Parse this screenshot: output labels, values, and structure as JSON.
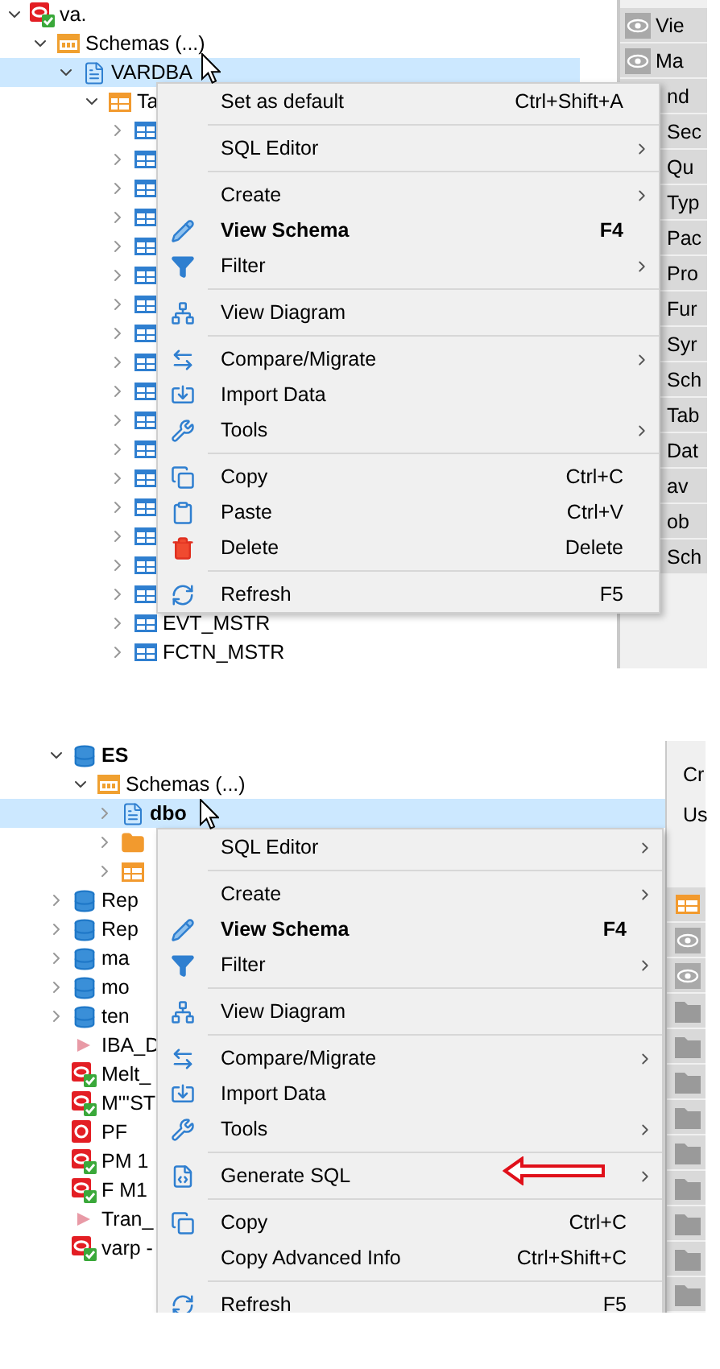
{
  "panels": [
    {
      "tree": [
        {
          "kind": "connected",
          "label": "va.",
          "expanded": true,
          "selected": false,
          "children": [
            {
              "kind": "schemas",
              "label": "Schemas (...)",
              "expanded": true,
              "selected": false,
              "children": [
                {
                  "kind": "schema",
                  "label": "VARDBA",
                  "expanded": true,
                  "selected": true,
                  "children": [
                    {
                      "kind": "tables",
                      "label": "Ta",
                      "expanded": true,
                      "selected": false,
                      "children": [
                        {
                          "kind": "table",
                          "expanded": false,
                          "selected": false
                        },
                        {
                          "kind": "table",
                          "expanded": false,
                          "selected": false
                        },
                        {
                          "kind": "table",
                          "expanded": false,
                          "selected": false
                        },
                        {
                          "kind": "table",
                          "expanded": false,
                          "selected": false
                        },
                        {
                          "kind": "table",
                          "expanded": false,
                          "selected": false
                        },
                        {
                          "kind": "table",
                          "expanded": false,
                          "selected": false
                        },
                        {
                          "kind": "table",
                          "expanded": false,
                          "selected": false
                        },
                        {
                          "kind": "table",
                          "expanded": false,
                          "selected": false
                        },
                        {
                          "kind": "table",
                          "expanded": false,
                          "selected": false
                        },
                        {
                          "kind": "table",
                          "expanded": false,
                          "selected": false
                        },
                        {
                          "kind": "table",
                          "expanded": false,
                          "selected": false
                        },
                        {
                          "kind": "table",
                          "expanded": false,
                          "selected": false
                        },
                        {
                          "kind": "table",
                          "expanded": false,
                          "selected": false
                        },
                        {
                          "kind": "table",
                          "expanded": false,
                          "selected": false
                        },
                        {
                          "kind": "table",
                          "expanded": false,
                          "selected": false
                        },
                        {
                          "kind": "table",
                          "expanded": false,
                          "selected": false
                        },
                        {
                          "kind": "table",
                          "expanded": false,
                          "selected": false
                        },
                        {
                          "kind": "table",
                          "label": "EVT_MSTR",
                          "expanded": false,
                          "selected": false
                        },
                        {
                          "kind": "table",
                          "label": "FCTN_MSTR",
                          "expanded": false,
                          "selected": false
                        }
                      ]
                    }
                  ]
                }
              ]
            }
          ]
        }
      ],
      "menu": [
        {
          "kind": "plain",
          "label": "Set as default",
          "shortcut": "Ctrl+Shift+A"
        },
        {
          "kind": "separator"
        },
        {
          "kind": "plain",
          "label": "SQL Editor",
          "submenu": true
        },
        {
          "kind": "separator"
        },
        {
          "kind": "plain",
          "label": "Create",
          "submenu": true
        },
        {
          "kind": "pencil",
          "label": "View Schema",
          "shortcut": "F4",
          "default": true
        },
        {
          "kind": "filter",
          "label": "Filter",
          "submenu": true
        },
        {
          "kind": "separator"
        },
        {
          "kind": "diagram",
          "label": "View Diagram"
        },
        {
          "kind": "separator"
        },
        {
          "kind": "compare",
          "label": "Compare/Migrate",
          "submenu": true
        },
        {
          "kind": "import",
          "label": "Import Data"
        },
        {
          "kind": "tools",
          "label": "Tools",
          "submenu": true
        },
        {
          "kind": "separator"
        },
        {
          "kind": "copy",
          "label": "Copy",
          "shortcut": "Ctrl+C"
        },
        {
          "kind": "paste",
          "label": "Paste",
          "shortcut": "Ctrl+V"
        },
        {
          "kind": "delete",
          "label": "Delete",
          "shortcut": "Delete"
        },
        {
          "kind": "separator"
        },
        {
          "kind": "refresh",
          "label": "Refresh",
          "shortcut": "F5"
        }
      ],
      "side_panel": {
        "rows": [
          {
            "label": "Vie",
            "kind": "view"
          },
          {
            "label": "Ma",
            "kind": "view"
          },
          {
            "label": "nd",
            "kind": "plain"
          },
          {
            "label": "Sec",
            "kind": "plain"
          },
          {
            "label": "Qu",
            "kind": "plain"
          },
          {
            "label": "Typ",
            "kind": "plain"
          },
          {
            "label": "Pac",
            "kind": "plain"
          },
          {
            "label": "Pro",
            "kind": "plain"
          },
          {
            "label": "Fur",
            "kind": "plain"
          },
          {
            "label": "Syr",
            "kind": "plain"
          },
          {
            "label": "Sch",
            "kind": "plain"
          },
          {
            "label": "Tab",
            "kind": "plain"
          },
          {
            "label": "Dat",
            "kind": "plain"
          },
          {
            "label": "av",
            "kind": "plain"
          },
          {
            "label": "ob",
            "kind": "plain"
          },
          {
            "label": "Sch",
            "kind": "plain"
          }
        ]
      }
    },
    {
      "tree": [
        {
          "kind": "database",
          "label": "ES",
          "expanded": true,
          "selected": false,
          "children": [
            {
              "kind": "schemas",
              "label": "Schemas (...)",
              "expanded": true,
              "selected": false,
              "children": [
                {
                  "kind": "schema",
                  "label": "dbo",
                  "expanded": false,
                  "selected": true
                },
                {
                  "kind": "folder",
                  "expanded": false,
                  "selected": false
                },
                {
                  "kind": "tables",
                  "expanded": false,
                  "selected": false
                }
              ]
            }
          ]
        },
        {
          "kind": "database",
          "label": "Rep",
          "expanded": false,
          "selected": false
        },
        {
          "kind": "database",
          "label": "Rep",
          "expanded": false,
          "selected": false
        },
        {
          "kind": "database",
          "label": "ma",
          "expanded": false,
          "selected": false
        },
        {
          "kind": "database",
          "label": "mo",
          "expanded": false,
          "selected": false
        },
        {
          "kind": "database",
          "label": "ten",
          "expanded": false,
          "selected": false
        },
        {
          "kind": "idle",
          "label": "IBA_D",
          "selected": false
        },
        {
          "kind": "connected",
          "label": "Melt_",
          "selected": false
        },
        {
          "kind": "connected",
          "label": "M'''ST",
          "selected": false
        },
        {
          "kind": "failed",
          "label": "PF",
          "selected": false
        },
        {
          "kind": "connected",
          "label": "PM 1",
          "selected": false
        },
        {
          "kind": "connected",
          "label": "F M1",
          "selected": false
        },
        {
          "kind": "idle",
          "label": "Tran_",
          "selected": false
        },
        {
          "kind": "connected",
          "label": "varp -",
          "selected": false
        }
      ],
      "menu": [
        {
          "kind": "plain",
          "label": "SQL Editor",
          "submenu": true
        },
        {
          "kind": "separator"
        },
        {
          "kind": "plain",
          "label": "Create",
          "submenu": true
        },
        {
          "kind": "pencil",
          "label": "View Schema",
          "shortcut": "F4",
          "default": true
        },
        {
          "kind": "filter",
          "label": "Filter",
          "submenu": true
        },
        {
          "kind": "separator"
        },
        {
          "kind": "diagram",
          "label": "View Diagram"
        },
        {
          "kind": "separator"
        },
        {
          "kind": "compare",
          "label": "Compare/Migrate",
          "submenu": true
        },
        {
          "kind": "import",
          "label": "Import Data"
        },
        {
          "kind": "tools",
          "label": "Tools",
          "submenu": true
        },
        {
          "kind": "separator"
        },
        {
          "kind": "sql",
          "label": "Generate SQL",
          "submenu": true
        },
        {
          "kind": "separator"
        },
        {
          "kind": "copy",
          "label": "Copy",
          "shortcut": "Ctrl+C"
        },
        {
          "kind": "plain",
          "label": "Copy Advanced Info",
          "shortcut": "Ctrl+Shift+C"
        },
        {
          "kind": "separator"
        },
        {
          "kind": "refresh",
          "label": "Refresh",
          "shortcut": "F5"
        }
      ],
      "callout": {
        "kind": "arrow"
      },
      "side_panel": {
        "fields": [
          "Cr",
          "Us"
        ],
        "rows": [
          {
            "kind": "table"
          },
          {
            "kind": "view"
          },
          {
            "kind": "view"
          },
          {
            "kind": "folder"
          },
          {
            "kind": "folder"
          },
          {
            "kind": "folder"
          },
          {
            "kind": "folder"
          },
          {
            "kind": "folder"
          },
          {
            "kind": "folder"
          },
          {
            "kind": "folder"
          },
          {
            "kind": "folder"
          },
          {
            "kind": "folder"
          }
        ]
      }
    }
  ]
}
